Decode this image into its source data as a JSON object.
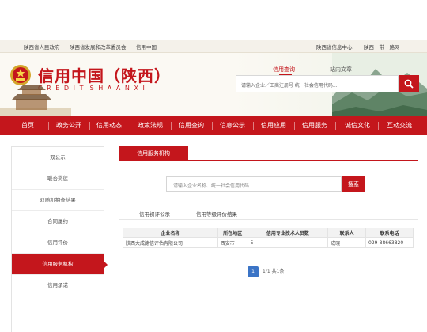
{
  "top_links": {
    "gov": "陕西省人民政府",
    "ndrc": "陕西省发展和改革委员会",
    "credit_china": "信用中国",
    "info_center": "陕西省信息中心",
    "one_net": "陕西一带一路网"
  },
  "header": {
    "logo_cn": "信用中国（陕西）",
    "logo_en_letters": [
      "C",
      "R",
      "E",
      "D",
      "I",
      "T",
      "",
      "S",
      "H",
      "A",
      "A",
      "N",
      "X",
      "I"
    ],
    "search_tab_active": "信用查询",
    "search_tab_other": "站内文章",
    "search_placeholder": "请输入企业／工商注册号 统一社会信用代码..."
  },
  "nav": [
    "首页",
    "政务公开",
    "信用动态",
    "政策法规",
    "信用查询",
    "信息公示",
    "信用应用",
    "信用服务",
    "诚信文化",
    "互动交流"
  ],
  "sidebar": {
    "items": [
      "双公示",
      "联合奖惩",
      "双随机抽查结果",
      "合同履约",
      "信用评价",
      "信用服务机构",
      "信用承诺"
    ],
    "active_index": 5
  },
  "main": {
    "title": "信用服务机构",
    "search_placeholder": "请输入企业名称、统一社会信用代码...",
    "search_button": "搜索",
    "tabs": [
      "信用初评公示",
      "信用等级评价结果"
    ]
  },
  "table": {
    "headers": [
      "企业名称",
      "所在地区",
      "信用专业技术人员数",
      "联系人",
      "联系电话"
    ],
    "rows": [
      [
        "陕西大成德信评估有限公司",
        "西安市",
        "5",
        "成晓",
        "029-88663820"
      ]
    ]
  },
  "pager": {
    "current_page": "1",
    "summary": "1/1 共1条"
  },
  "colors": {
    "brand_red": "#c4161c",
    "pager_blue": "#3b74c6"
  }
}
